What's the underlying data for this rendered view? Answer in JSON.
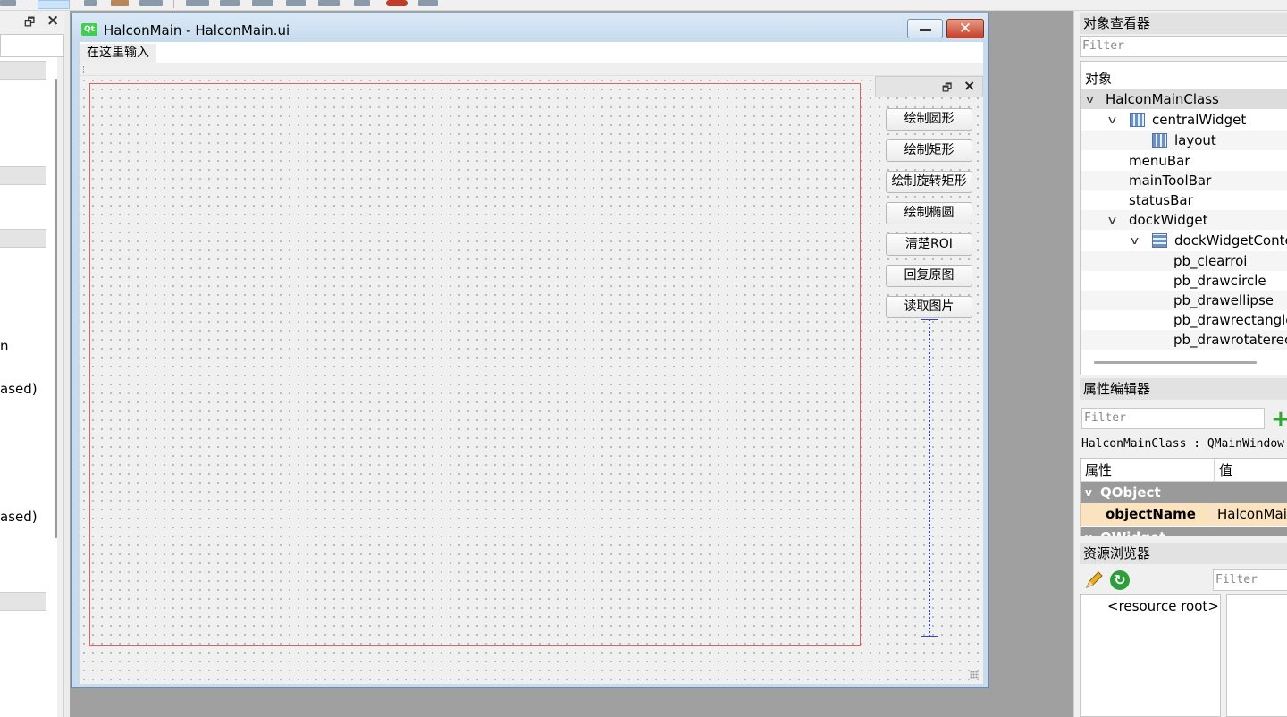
{
  "left_panel": {
    "truncated_texts": [
      "n",
      "ased)",
      "ased)"
    ]
  },
  "form_window": {
    "qt_badge": "Qt",
    "title": "HalconMain - HalconMain.ui",
    "close_glyph": "✕",
    "menu_placeholder": "在这里输入",
    "dock_buttons": [
      "绘制圆形",
      "绘制矩形",
      "绘制旋转矩形",
      "绘制椭圆",
      "清楚ROI",
      "回复原图",
      "读取图片"
    ]
  },
  "object_inspector": {
    "title": "对象查看器",
    "filter_placeholder": "Filter",
    "header": "对象",
    "tree": [
      {
        "label": "HalconMainClass"
      },
      {
        "label": "centralWidget"
      },
      {
        "label": "layout"
      },
      {
        "label": "menuBar"
      },
      {
        "label": "mainToolBar"
      },
      {
        "label": "statusBar"
      },
      {
        "label": "dockWidget"
      },
      {
        "label": "dockWidgetConte"
      },
      {
        "label": "pb_clearroi"
      },
      {
        "label": "pb_drawcircle"
      },
      {
        "label": "pb_drawellipse"
      },
      {
        "label": "pb_drawrectangle"
      },
      {
        "label": "pb_drawrotaterec"
      }
    ]
  },
  "property_editor": {
    "title": "属性编辑器",
    "filter_placeholder": "Filter",
    "class_line": "HalconMainClass : QMainWindow",
    "col_property": "属性",
    "col_value": "值",
    "group_1": "QObject",
    "prop_name": "objectName",
    "prop_value": "HalconMain",
    "group_2": "QWidget"
  },
  "resource_browser": {
    "title": "资源浏览器",
    "filter_placeholder": "Filter",
    "root_label": "<resource root>"
  },
  "colors": {
    "layout_frame": "#e06060",
    "spacer": "#3344cc",
    "selected_property": "#fbe3bf",
    "group_header": "#9a9a9a"
  }
}
